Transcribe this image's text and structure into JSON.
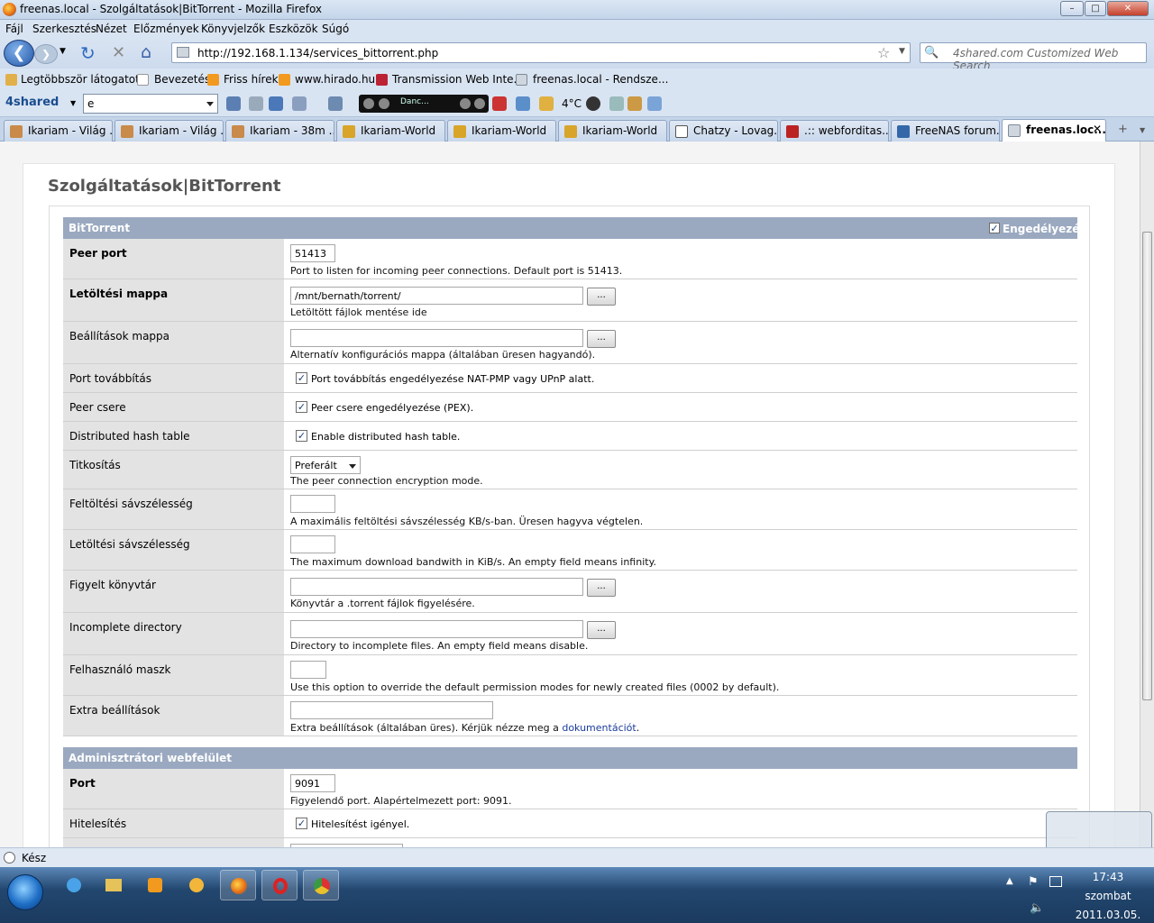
{
  "window": {
    "title": "freenas.local - Szolgáltatások|BitTorrent - Mozilla Firefox",
    "min": "–",
    "max": "□",
    "close": "✕"
  },
  "menu": [
    "Fájl",
    "Szerkesztés",
    "Nézet",
    "Előzmények",
    "Könyvjelzők",
    "Eszközök",
    "Súgó"
  ],
  "nav": {
    "url": "http://192.168.1.134/services_bittorrent.php",
    "search_placeholder": "4shared.com Customized Web Search"
  },
  "bookmarks": [
    "Legtöbbször látogatott",
    "Bevezetés",
    "Friss hírek",
    "www.hirado.hu",
    "Transmission Web Inte...",
    "freenas.local - Rendsze..."
  ],
  "toolbar": {
    "logo": "4shared",
    "search_value": "e",
    "media_text": "Danc...",
    "temperature": "4°C"
  },
  "tabs": [
    "Ikariam - Világ ...",
    "Ikariam - Világ ...",
    "Ikariam - 38m ...",
    "Ikariam-World",
    "Ikariam-World",
    "Ikariam-World",
    "Chatzy - Lovag...",
    ".:: webforditas....",
    "FreeNAS forum...",
    "freenas.loc..."
  ],
  "page": {
    "title": "Szolgáltatások|BitTorrent",
    "section1": {
      "title": "BitTorrent",
      "enable_label": "Engedélyezés",
      "enabled": true
    },
    "rows": {
      "peer_port": {
        "label": "Peer port",
        "value": "51413",
        "desc": "Port to listen for incoming peer connections. Default port is 51413."
      },
      "download_dir": {
        "label": "Letöltési mappa",
        "value": "/mnt/bernath/torrent/",
        "desc": "Letöltött fájlok mentése ide"
      },
      "config_dir": {
        "label": "Beállítások mappa",
        "value": "",
        "desc": "Alternatív konfigurációs mappa (általában üresen hagyandó)."
      },
      "port_forward": {
        "label": "Port továbbítás",
        "checkbox": "Port továbbítás engedélyezése NAT-PMP vagy UPnP alatt."
      },
      "pex": {
        "label": "Peer csere",
        "checkbox": "Peer csere engedélyezése (PEX)."
      },
      "dht": {
        "label": "Distributed hash table",
        "checkbox": "Enable distributed hash table."
      },
      "encryption": {
        "label": "Titkosítás",
        "value": "Preferált",
        "desc": "The peer connection encryption mode."
      },
      "upload_bw": {
        "label": "Feltöltési sávszélesség",
        "value": "",
        "desc": "A maximális feltöltési sávszélesség KB/s-ban. Üresen hagyva végtelen."
      },
      "download_bw": {
        "label": "Letöltési sávszélesség",
        "value": "",
        "desc": "The maximum download bandwith in KiB/s. An empty field means infinity."
      },
      "watch_dir": {
        "label": "Figyelt könyvtár",
        "value": "",
        "desc": "Könyvtár a .torrent fájlok figyelésére."
      },
      "incomplete_dir": {
        "label": "Incomplete directory",
        "value": "",
        "desc": "Directory to incomplete files. An empty field means disable."
      },
      "umask": {
        "label": "Felhasználó maszk",
        "value": "",
        "desc": "Use this option to override the default permission modes for newly created files (0002 by default)."
      },
      "extra": {
        "label": "Extra beállítások",
        "value": "",
        "desc": "Extra beállítások (általában üres). Kérjük nézze meg a",
        "link": "dokumentációt",
        "desc_end": "."
      }
    },
    "section2": {
      "title": "Adminisztrátori webfelület"
    },
    "admin": {
      "port": {
        "label": "Port",
        "value": "9091",
        "desc": "Figyelendő port. Alapértelmezett port: 9091."
      },
      "auth": {
        "label": "Hitelesítés",
        "checkbox": "Hitelesítést igényel."
      }
    },
    "browse_label": "..."
  },
  "status": "Kész",
  "clock": {
    "time": "17:43",
    "day": "szombat",
    "date": "2011.03.05."
  }
}
